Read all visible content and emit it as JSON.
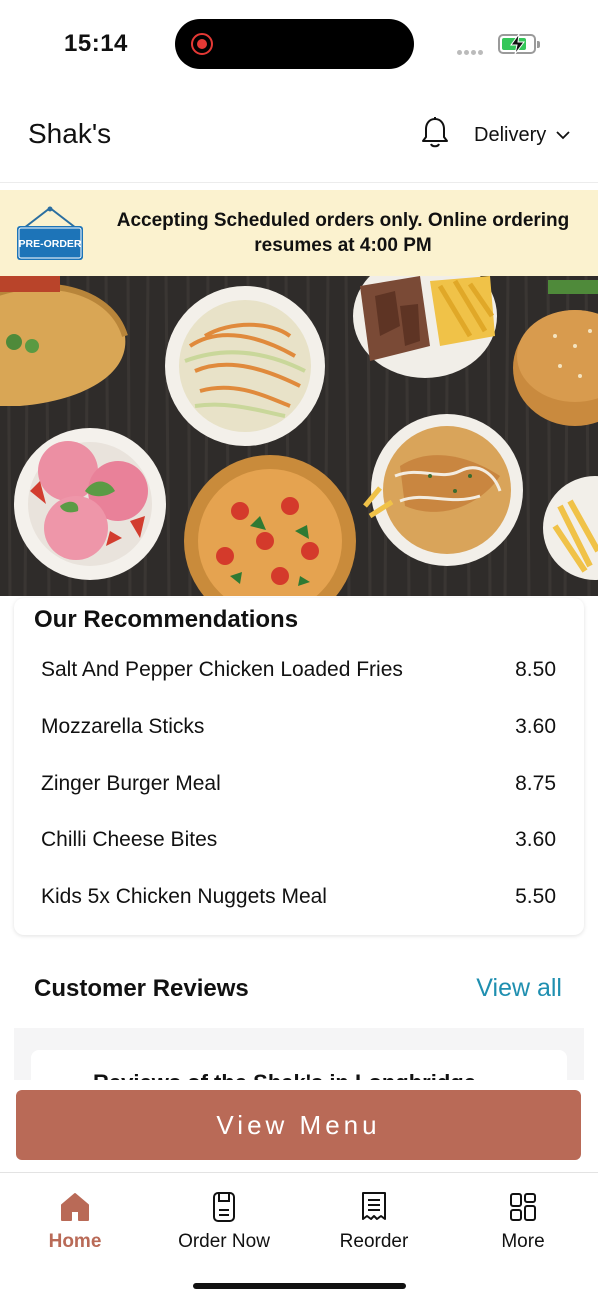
{
  "status_bar": {
    "time": "15:14",
    "battery_color": "#34c759"
  },
  "header": {
    "store_name": "Shak's",
    "delivery_mode": "Delivery",
    "bell_icon": "bell-icon"
  },
  "banner": {
    "sign_text": "PRE-ORDER",
    "message": "Accepting Scheduled orders only. Online ordering resumes at 4:00 PM",
    "background": "#fbf2cf"
  },
  "hero": {
    "image": "food-spread-photo"
  },
  "recommendations": {
    "title": "Our Recommendations",
    "items": [
      {
        "name": "Salt And Pepper Chicken Loaded Fries",
        "price": "8.50"
      },
      {
        "name": "Mozzarella Sticks",
        "price": "3.60"
      },
      {
        "name": "Zinger Burger Meal",
        "price": "8.75"
      },
      {
        "name": "Chilli Cheese Bites",
        "price": "3.60"
      },
      {
        "name": "Kids 5x Chicken Nuggets Meal",
        "price": "5.50"
      }
    ]
  },
  "reviews": {
    "title": "Customer Reviews",
    "view_all": "View all",
    "partial_text": "Reviews of the Shak's in Longbridge"
  },
  "cta": {
    "label": "View Menu",
    "color": "#b96a57"
  },
  "tabs": [
    {
      "label": "Home",
      "icon": "home-icon",
      "active": true
    },
    {
      "label": "Order Now",
      "icon": "order-icon",
      "active": false
    },
    {
      "label": "Reorder",
      "icon": "receipt-icon",
      "active": false
    },
    {
      "label": "More",
      "icon": "grid-icon",
      "active": false
    }
  ],
  "colors": {
    "accent": "#b96a57",
    "link": "#1f8fb0"
  }
}
